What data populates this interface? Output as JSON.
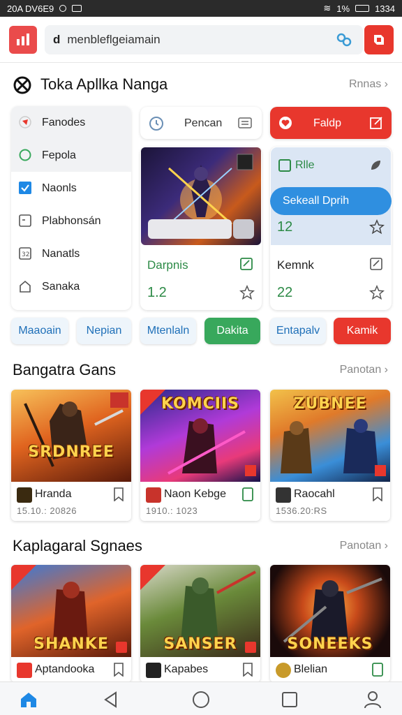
{
  "status": {
    "time_left": "20A DV6E9",
    "battery": "1%",
    "clock": "1334"
  },
  "url_bar": {
    "prefix": "d",
    "url": "menbleflgeiamain"
  },
  "section1": {
    "title": "Toka Apllka Nanga",
    "more": "Rnnas"
  },
  "side_menu": [
    {
      "label": "Fanodes",
      "icon": "pin-icon"
    },
    {
      "label": "Fepola",
      "icon": "circle-icon"
    },
    {
      "label": "Naonls",
      "icon": "checkbox-icon"
    },
    {
      "label": "Plabhonsán",
      "icon": "square-icon"
    },
    {
      "label": "Nanatls",
      "icon": "grid-icon"
    },
    {
      "label": "Sanaka",
      "icon": "house-icon"
    }
  ],
  "search_card": {
    "label": "Pencan"
  },
  "red_card": {
    "label": "Faldp"
  },
  "feature_card_a": {
    "title": "Darpnis",
    "value": "1.2"
  },
  "feature_card_b": {
    "tag": "Rlle",
    "button": "Sekeall Dprih",
    "number": "12",
    "title": "Kemnk",
    "value": "22"
  },
  "pills": [
    "Maaoain",
    "Nepian",
    "Mtenlaln",
    "Dakita",
    "Entapalv",
    "Kamik"
  ],
  "section2": {
    "title": "Bangatra Gans",
    "more": "Panotan"
  },
  "games_row1": [
    {
      "art_title": "SRDNREE",
      "name": "Hranda",
      "date": "15.10.: 20826",
      "accent": "#f39a2b"
    },
    {
      "art_title": "KOMCIIS",
      "name": "Naon Kebge",
      "date": "1910.: 1023",
      "accent": "#a93cd0"
    },
    {
      "art_title": "ZUBNEE",
      "name": "Raocahl",
      "date": "1536.20:RS",
      "accent": "#3da0e0"
    }
  ],
  "section3": {
    "title": "Kaplagaral Sgnaes",
    "more": "Panotan"
  },
  "games_row2": [
    {
      "art_title": "SHANKE",
      "name": "Aptandooka"
    },
    {
      "art_title": "SANSER",
      "name": "Kapabes"
    },
    {
      "art_title": "SONEEKS",
      "name": "Blelian"
    }
  ]
}
